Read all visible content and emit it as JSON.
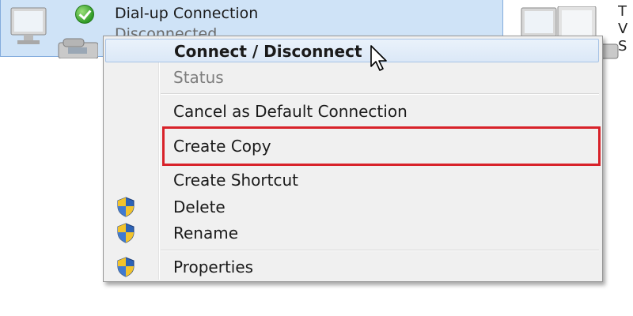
{
  "connection": {
    "name": "Dial-up Connection",
    "status": "Disconnected"
  },
  "edge_text": "T\nV\nS",
  "menu": {
    "items": [
      {
        "label": "Connect / Disconnect",
        "bold": true
      },
      {
        "label": "Status",
        "disabled": true
      },
      {
        "label": "Cancel as Default Connection"
      },
      {
        "label": "Create Copy",
        "highlighted": true
      },
      {
        "label": "Create Shortcut"
      },
      {
        "label": "Delete",
        "icon": "uac-shield-icon"
      },
      {
        "label": "Rename",
        "icon": "uac-shield-icon"
      },
      {
        "label": "Properties",
        "icon": "uac-shield-icon"
      }
    ]
  },
  "colors": {
    "selection": "#cfe3f7",
    "highlight_box": "#d8222a",
    "menu_bg": "#f0f0f0"
  }
}
